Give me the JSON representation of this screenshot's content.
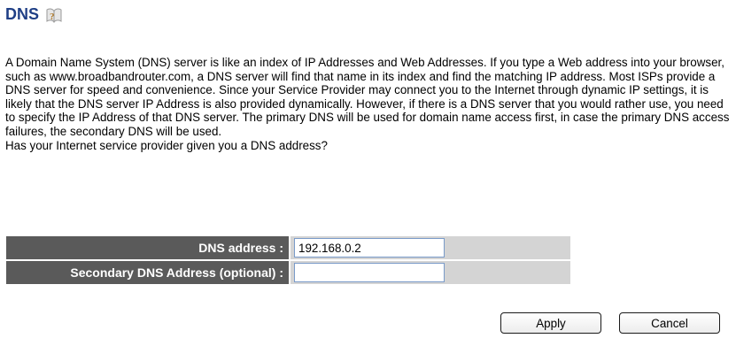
{
  "page": {
    "title": "DNS"
  },
  "description": {
    "paragraph": "A Domain Name System (DNS) server is like an index of IP Addresses and Web Addresses. If you type a Web address into your browser, such as www.broadbandrouter.com, a DNS server will find that name in its index and find the matching IP address. Most ISPs provide a DNS server for speed and convenience. Since your Service Provider may connect you to the Internet through dynamic IP settings, it is likely that the DNS server IP Address is also provided dynamically. However, if there is a DNS server that you would rather use, you need to specify the IP Address of that DNS server. The primary DNS will be used for domain name access first, in case the primary DNS access failures, the secondary DNS will be used.",
    "question": "Has your Internet service provider given you a DNS address?"
  },
  "form": {
    "dns_label": "DNS address :",
    "dns_value": "192.168.0.2",
    "secondary_label": "Secondary DNS Address (optional) :",
    "secondary_value": ""
  },
  "buttons": {
    "apply": "Apply",
    "cancel": "Cancel"
  },
  "icons": {
    "help": "help-icon"
  },
  "colors": {
    "title": "#1f3f86",
    "label_bg": "#5a5a5a",
    "value_bg": "#d4d4d4"
  }
}
